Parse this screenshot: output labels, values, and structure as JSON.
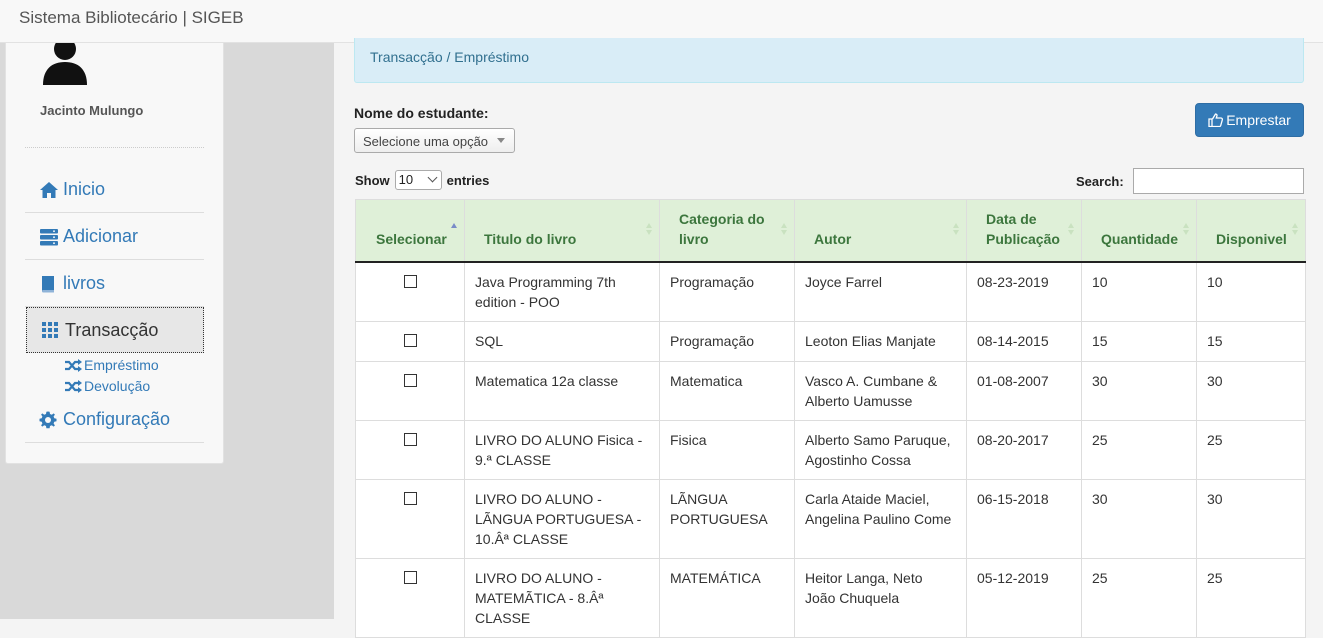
{
  "app": {
    "title": "Sistema Bibliotecário | SIGEB"
  },
  "sidebar": {
    "username": "Jacinto Mulungo",
    "items": [
      {
        "label": "Inicio",
        "icon": "home-icon"
      },
      {
        "label": "Adicionar",
        "icon": "server-icon"
      },
      {
        "label": "livros",
        "icon": "book-icon"
      },
      {
        "label": "Transacção",
        "icon": "grid-icon"
      },
      {
        "label": "Configuração",
        "icon": "gear-icon"
      }
    ],
    "subitems": [
      {
        "label": "Empréstimo",
        "icon": "shuffle-icon"
      },
      {
        "label": "Devolução",
        "icon": "shuffle-icon"
      }
    ]
  },
  "breadcrumb": "Transacção / Empréstimo",
  "form": {
    "student_label": "Nome do estudante:",
    "student_select": "Selecione uma opção",
    "lend_button": "Emprestar"
  },
  "table_controls": {
    "show": "Show",
    "length_value": "10",
    "entries": "entries",
    "search_label": "Search:",
    "search_value": ""
  },
  "table": {
    "columns": [
      "Selecionar",
      "Titulo do livro",
      "Categoria do livro",
      "Autor",
      "Data de Publicação",
      "Quantidade",
      "Disponivel"
    ],
    "rows": [
      {
        "title": "Java Programming 7th edition - POO",
        "category": "Programação",
        "author": "Joyce Farrel",
        "date": "08-23-2019",
        "qty": "10",
        "available": "10"
      },
      {
        "title": "SQL",
        "category": "Programação",
        "author": "Leoton Elias Manjate",
        "date": "08-14-2015",
        "qty": "15",
        "available": "15"
      },
      {
        "title": "Matematica 12a classe",
        "category": "Matematica",
        "author": "Vasco A. Cumbane & Alberto Uamusse",
        "date": "01-08-2007",
        "qty": "30",
        "available": "30"
      },
      {
        "title": "LIVRO DO ALUNO Fisica - 9.ª CLASSE",
        "category": "Fisica",
        "author": "Alberto Samo Paruque, Agostinho Cossa",
        "date": "08-20-2017",
        "qty": "25",
        "available": "25"
      },
      {
        "title": "LIVRO DO ALUNO - LÃNGUA PORTUGUESA - 10.Âª CLASSE",
        "category": "LÃNGUA PORTUGUESA",
        "author": "Carla Ataide Maciel, Angelina Paulino Come",
        "date": "06-15-2018",
        "qty": "30",
        "available": "30"
      },
      {
        "title": "LIVRO DO ALUNO - MATEMÃTICA - 8.Âª CLASSE",
        "category": "MATEMÁTICA",
        "author": "Heitor Langa, Neto João  Chuquela",
        "date": "05-12-2019",
        "qty": "25",
        "available": "25"
      }
    ]
  },
  "colors": {
    "accent": "#337ab7",
    "header_bg": "#dff0d8",
    "header_text": "#3c763d",
    "breadcrumb_bg": "#d9edf7"
  }
}
